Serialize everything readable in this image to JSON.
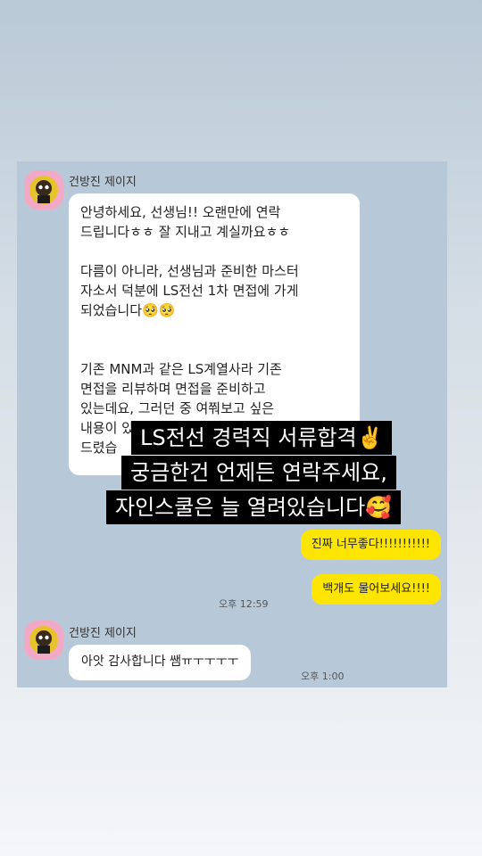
{
  "chat": {
    "sender_name": "건방진 제이지",
    "message1": {
      "paragraphs": [
        "안녕하세요, 선생님!! 오랜만에 연락\n드립니다ㅎㅎ 잘 지내고 계실까요ㅎㅎ",
        "다름이 아니라, 선생님과 준비한 마스터\n자소서 덕분에 LS전선 1차 면접에 가게\n되었습니다🥺🥺",
        "기존 MNM과 같은 LS계열사라 기존\n면접을 리뷰하며 면접을 준비하고\n있는데요, 그러던 중 여쭤보고 싶은\n내용이 있\n드렸습"
      ]
    },
    "reply1": "진짜 너무좋다!!!!!!!!!!!",
    "reply2": "백개도 물어보세요!!!!",
    "reply_time": "오후 12:59",
    "message2": "아앗 감사합니다 쌤ㅠㅜㅜㅜㅜ",
    "message2_time": "오후 1:00"
  },
  "overlay": {
    "line1": "LS전선 경력직 서류합격✌️",
    "line2": "궁금한건 언제든 연락주세요,",
    "line3": "자인스쿨은 늘 열려있습니다🥰"
  },
  "icons": {
    "avatar": "cartoon-avatar-icon"
  },
  "colors": {
    "chat_bg": "#b7c9d9",
    "my_bubble": "#fee500",
    "their_bubble": "#ffffff",
    "avatar_bg": "#f2a9c6"
  }
}
